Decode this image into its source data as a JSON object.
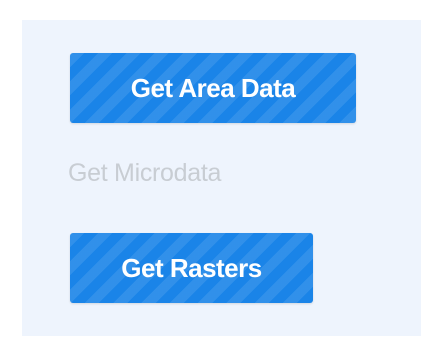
{
  "panel": {
    "background": "#eef4fd",
    "accent_color": "#1a84e8",
    "disabled_color": "#c8cdd3",
    "buttons": {
      "get_area_data": "Get Area Data",
      "get_microdata": "Get Microdata",
      "get_rasters": "Get Rasters"
    }
  }
}
